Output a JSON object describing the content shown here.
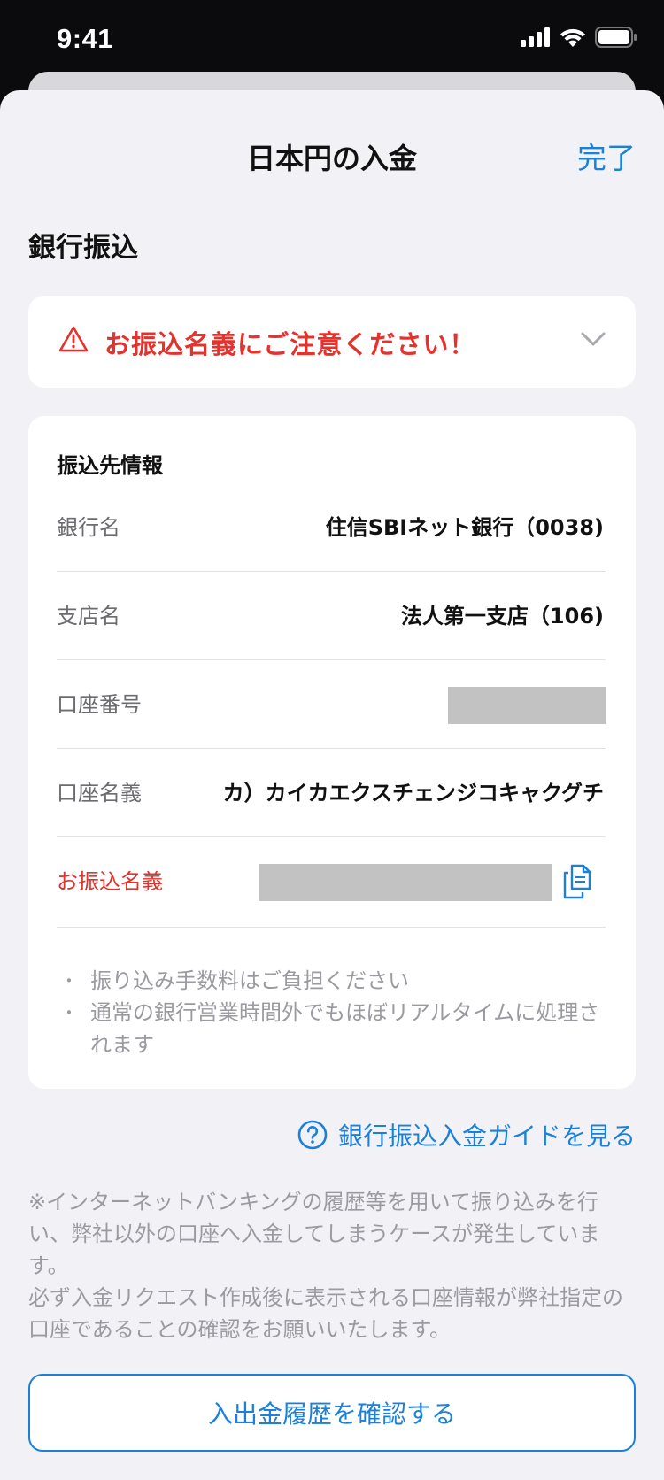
{
  "status_bar": {
    "time": "9:41",
    "icons": [
      "signal-icon",
      "wifi-icon",
      "battery-icon"
    ]
  },
  "header": {
    "title": "日本円の入金",
    "done_label": "完了"
  },
  "section": {
    "title": "銀行振込"
  },
  "warning": {
    "text": "お振込名義にご注意ください！",
    "icon": "warning-triangle-icon",
    "color": "#e5322c"
  },
  "transfer_info": {
    "header": "振込先情報",
    "rows": [
      {
        "label": "銀行名",
        "value": "住信SBIネット銀行（0038)"
      },
      {
        "label": "支店名",
        "value": "法人第一支店（106)"
      },
      {
        "label": "口座番号",
        "value": ""
      },
      {
        "label": "口座名義",
        "value": "カ）カイカエクスチェンジコキャクグチ"
      },
      {
        "label": "お振込名義",
        "value": ""
      }
    ],
    "notes": [
      "振り込み手数料はご負担ください",
      "通常の銀行営業時間外でもほぼリアルタイムに処理されます"
    ]
  },
  "guide": {
    "label": "銀行振込入金ガイドを見る",
    "icon": "question-circle-icon"
  },
  "disclaimer": {
    "lines": [
      "※インターネットバンキングの履歴等を用いて振り込みを行い、弊社以外の口座へ入金してしまうケースが発生しています。",
      "必ず入金リクエスト作成後に表示される口座情報が弊社指定の口座であることの確認をお願いいたします。"
    ]
  },
  "history_button": {
    "label": "入出金履歴を確認する"
  },
  "colors": {
    "accent": "#1a80d9",
    "warning": "#e5322c",
    "background": "#f2f2f6"
  }
}
